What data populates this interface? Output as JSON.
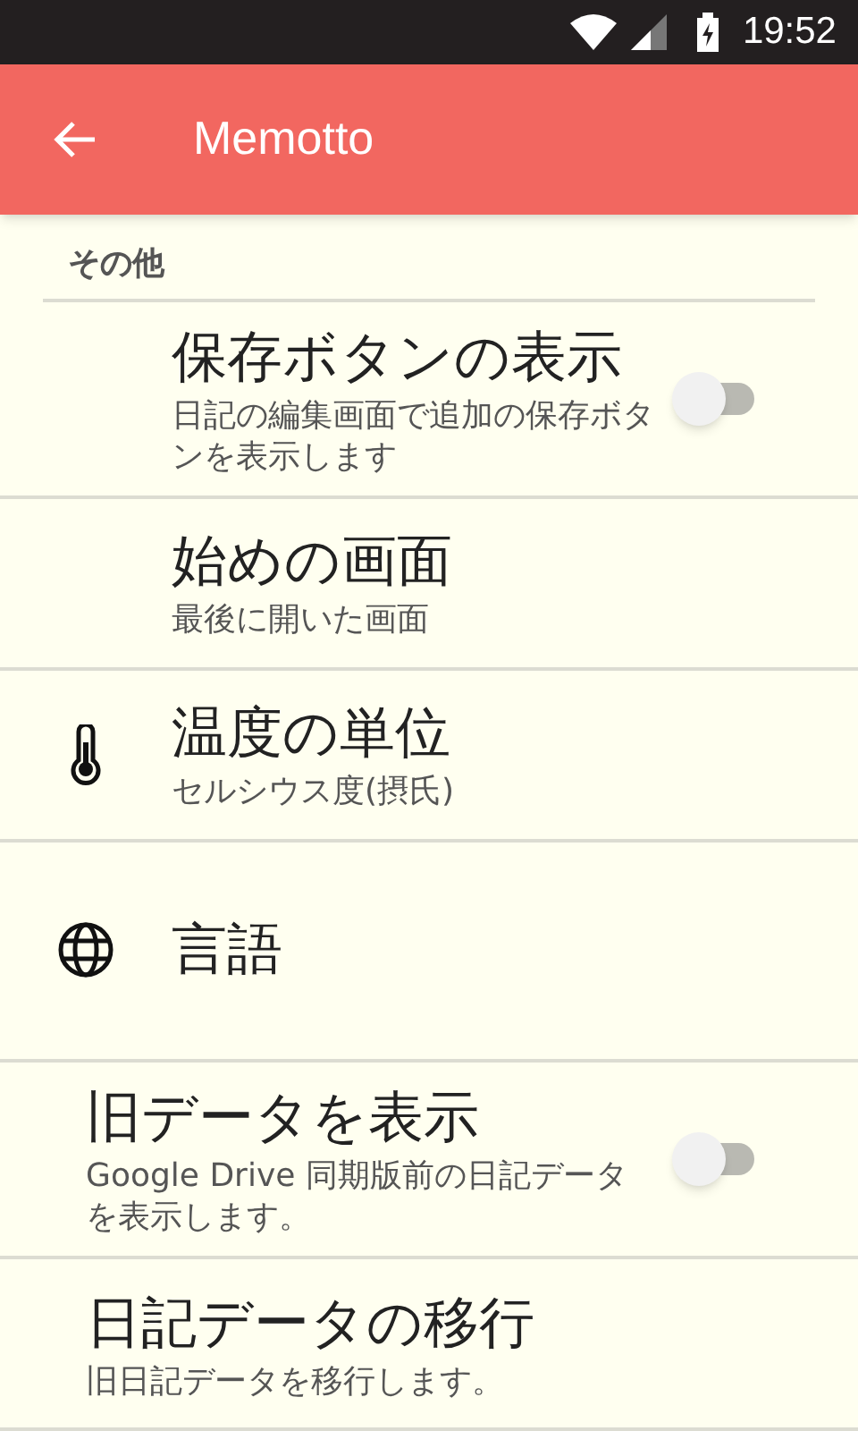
{
  "status_bar": {
    "time": "19:52"
  },
  "app_bar": {
    "title": "Memotto"
  },
  "section": {
    "title": "その他"
  },
  "items": [
    {
      "kind": "toggle",
      "title": "保存ボタンの表示",
      "subtitle": "日記の編集画面で追加の保存ボタンを表示します",
      "on": false
    },
    {
      "kind": "text",
      "title": "始めの画面",
      "subtitle": "最後に開いた画面"
    },
    {
      "kind": "text",
      "title": "温度の単位",
      "subtitle": "セルシウス度(摂氏)"
    },
    {
      "kind": "text",
      "title": "言語"
    }
  ],
  "legacy_items": [
    {
      "kind": "toggle",
      "title": "旧データを表示",
      "subtitle": "Google Drive 同期版前の日記データを表示します。",
      "on": false
    },
    {
      "kind": "text",
      "title": "日記データの移行",
      "subtitle": "旧日記データを移行します。"
    }
  ]
}
